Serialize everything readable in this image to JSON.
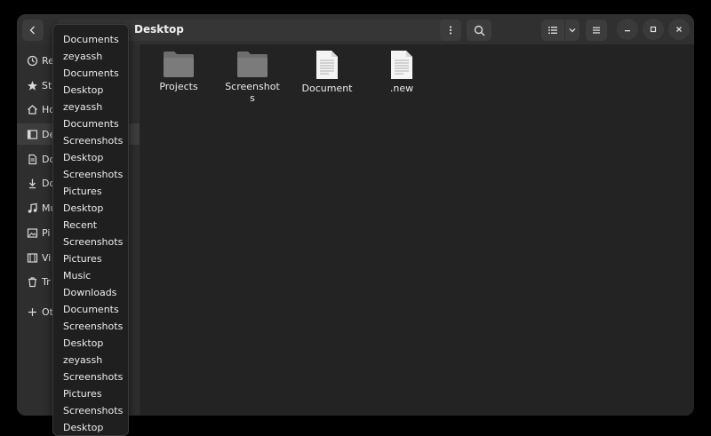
{
  "header": {
    "path_current": "Desktop",
    "icons": {
      "back": "chevron-left-icon",
      "menu": "vertical-dots-icon",
      "search": "search-icon",
      "view_list": "list-view-icon",
      "view_toggle": "chevron-down-icon",
      "main_menu": "hamburger-icon",
      "minimize": "minimize-icon",
      "maximize": "maximize-icon",
      "close": "close-icon"
    }
  },
  "sidebar": {
    "items": [
      {
        "label": "Re",
        "icon": "recent-icon"
      },
      {
        "label": "St",
        "icon": "star-icon"
      },
      {
        "label": "Ho",
        "icon": "home-icon"
      },
      {
        "label": "De",
        "icon": "desktop-icon",
        "active": true
      },
      {
        "label": "Do",
        "icon": "document-icon"
      },
      {
        "label": "Do",
        "icon": "download-icon"
      },
      {
        "label": "Mu",
        "icon": "music-icon"
      },
      {
        "label": "Pi",
        "icon": "picture-icon"
      },
      {
        "label": "Vi",
        "icon": "video-icon"
      },
      {
        "label": "Tr",
        "icon": "trash-icon"
      },
      {
        "label": "Ot",
        "icon": "plus-icon"
      }
    ]
  },
  "files": [
    {
      "name": "Projects",
      "type": "folder"
    },
    {
      "name": "Screenshots",
      "type": "folder"
    },
    {
      "name": "Document",
      "type": "document"
    },
    {
      "name": ".new",
      "type": "document"
    }
  ],
  "history_menu": {
    "items": [
      "Documents",
      "zeyassh",
      "Documents",
      "Desktop",
      "zeyassh",
      "Documents",
      "Screenshots",
      "Desktop",
      "Screenshots",
      "Pictures",
      "Desktop",
      "Recent",
      "Screenshots",
      "Pictures",
      "Music",
      "Downloads",
      "Documents",
      "Screenshots",
      "Desktop",
      "zeyassh",
      "Screenshots",
      "Pictures",
      "Screenshots",
      "Desktop"
    ]
  },
  "colors": {
    "background": "#000000",
    "window": "#2b2b2b",
    "headerbar": "#303030",
    "sidebar": "#2e2e2e",
    "content": "#232323",
    "dropdown": "#1f1f1f"
  }
}
